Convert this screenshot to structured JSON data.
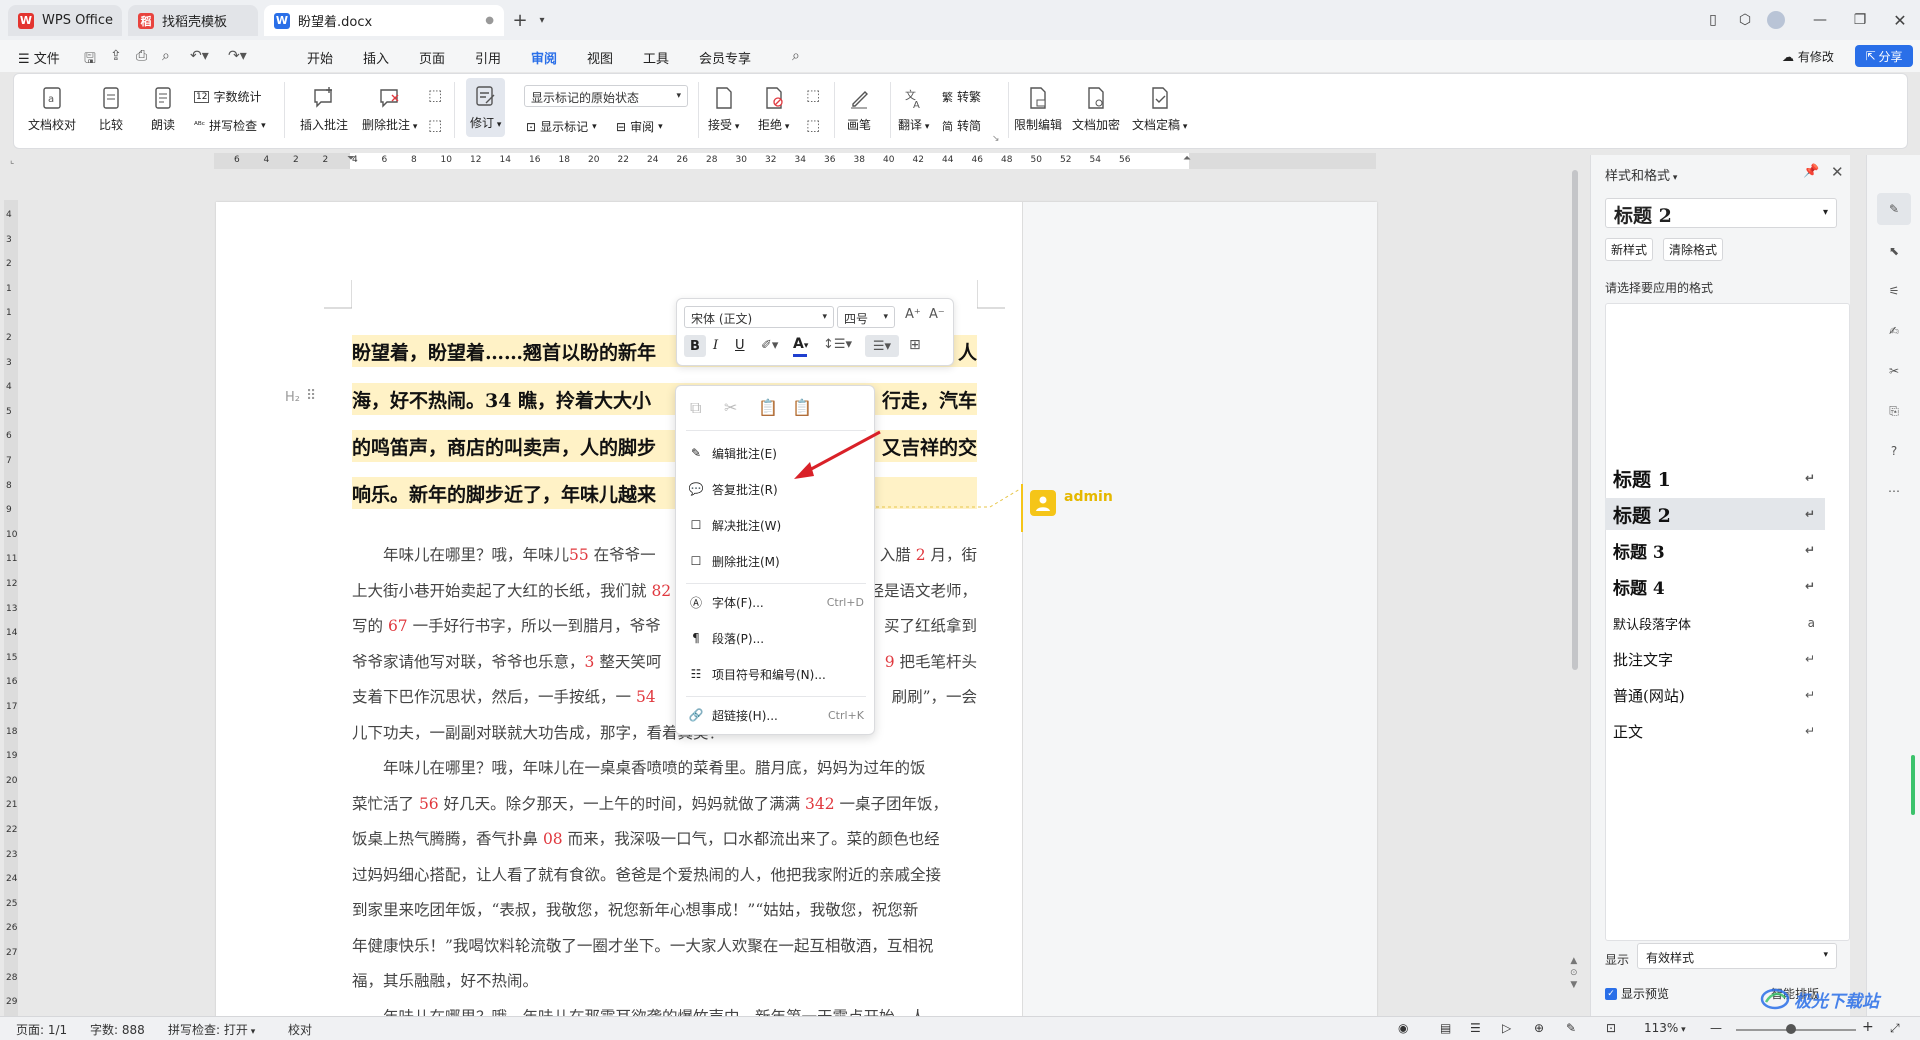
{
  "tabs": [
    {
      "label": "WPS Office",
      "icon": "wps-logo-icon"
    },
    {
      "label": "找稻壳模板",
      "icon": "docer-icon"
    },
    {
      "label": "盼望着.docx",
      "icon": "word-doc-icon"
    }
  ],
  "menubar": {
    "file": "文件",
    "items": [
      "开始",
      "插入",
      "页面",
      "引用",
      "审阅",
      "视图",
      "工具",
      "会员专享"
    ],
    "active": "审阅",
    "modified": "有修改",
    "share": "分享"
  },
  "ribbon": {
    "doc_check": "文档校对",
    "compare": "比较",
    "read_aloud": "朗读",
    "word_count": "字数统计",
    "spell_check": "拼写检查",
    "insert_comment": "插入批注",
    "delete_comment": "删除批注",
    "track": "修订",
    "display_mode": "显示标记的原始状态",
    "show_markup": "显示标记",
    "review": "审阅",
    "accept": "接受",
    "reject": "拒绝",
    "ink": "画笔",
    "translate": "翻译",
    "to_traditional": "转繁",
    "to_simplified": "转简",
    "restrict_edit": "限制编辑",
    "encrypt": "文档加密",
    "finalize": "文档定稿"
  },
  "ruler": {
    "h_ticks": [
      "6",
      "4",
      "2",
      "2",
      "4",
      "6",
      "8",
      "10",
      "12",
      "14",
      "16",
      "18",
      "20",
      "22",
      "24",
      "26",
      "28",
      "30",
      "32",
      "34",
      "36",
      "38",
      "40",
      "42",
      "44",
      "46",
      "48",
      "50",
      "52",
      "54",
      "56"
    ],
    "v_ticks": [
      "4",
      "3",
      "2",
      "1",
      "1",
      "2",
      "3",
      "4",
      "5",
      "6",
      "7",
      "8",
      "9",
      "10",
      "11",
      "12",
      "13",
      "14",
      "15",
      "16",
      "17",
      "18",
      "19",
      "20",
      "21",
      "22",
      "23",
      "24",
      "25",
      "26",
      "27",
      "28",
      "29"
    ]
  },
  "document": {
    "heading_marker": "H₂",
    "heading_lines": [
      {
        "left": "盼望着，盼望着……翘首以盼的新年",
        "right": "人"
      },
      {
        "left": "海，好不热闹。34 瞧，拎着大大小",
        "right": "行走，汽车"
      },
      {
        "left": "的鸣笛声，商店的叫卖声，人的脚步",
        "right": "又吉祥的交"
      },
      {
        "left": "响乐。新年的脚步近了，年味儿越来",
        "right": ""
      }
    ],
    "body_lines": [
      {
        "parts": [
          [
            "　　年味儿在哪里？哦，年味儿",
            0
          ],
          [
            "55",
            1
          ],
          [
            " 在爷爷一",
            0
          ]
        ],
        "right": [
          [
            "入腊 ",
            0
          ],
          [
            "2",
            1
          ],
          [
            " 月，街",
            0
          ]
        ]
      },
      {
        "parts": [
          [
            "上大街小巷开始卖起了大红的长纸，我们就 ",
            0
          ],
          [
            "82",
            1
          ]
        ],
        "right": [
          [
            "经是语文老师，",
            0
          ]
        ]
      },
      {
        "parts": [
          [
            "写的 ",
            0
          ],
          [
            "67",
            1
          ],
          [
            " 一手好行书字，所以一到腊月，爷爷",
            0
          ]
        ],
        "right": [
          [
            "买了红纸拿到",
            0
          ]
        ]
      },
      {
        "parts": [
          [
            "爷爷家请他写对联，爷爷也乐意，",
            0
          ],
          [
            "3",
            1
          ],
          [
            " 整天笑呵",
            0
          ]
        ],
        "right": [
          [
            "",
            0
          ],
          [
            "9",
            1
          ],
          [
            " 把毛笔杆头",
            0
          ]
        ]
      },
      {
        "parts": [
          [
            "支着下巴作沉思状，然后，一手按纸，一 ",
            0
          ],
          [
            "54",
            1
          ]
        ],
        "right": [
          [
            "刷刷”，一会",
            0
          ]
        ]
      },
      {
        "parts": [
          [
            "儿下功夫，一副副对联就大功告成，那字，看着真美！",
            0
          ]
        ],
        "right": []
      },
      {
        "parts": [
          [
            "　　年味儿在哪里？哦，年味儿在一桌桌香喷喷的菜肴里。腊月底，妈妈为过年的饭",
            0
          ]
        ],
        "right": []
      },
      {
        "parts": [
          [
            "菜忙活了 ",
            0
          ],
          [
            "56",
            1
          ],
          [
            " 好几天。除夕那天，一上午的时间，妈妈就做了满满 ",
            0
          ],
          [
            "342",
            1
          ],
          [
            " 一桌子团年饭，",
            0
          ]
        ],
        "right": []
      },
      {
        "parts": [
          [
            "饭桌上热气腾腾，香气扑鼻 ",
            0
          ],
          [
            "08",
            1
          ],
          [
            " 而来，我深吸一口气，口水都流出来了。菜的颜色也经",
            0
          ]
        ],
        "right": []
      },
      {
        "parts": [
          [
            "过妈妈细心搭配，让人看了就有食欲。爸爸是个爱热闹的人，他把我家附近的亲戚全接",
            0
          ]
        ],
        "right": []
      },
      {
        "parts": [
          [
            "到家里来吃团年饭，“表叔，我敬您，祝您新年心想事成！”“姑姑，我敬您，祝您新",
            0
          ]
        ],
        "right": []
      },
      {
        "parts": [
          [
            "年健康快乐！”我喝饮料轮流敬了一圈才坐下。一大家人欢聚在一起互相敬酒，互相祝",
            0
          ]
        ],
        "right": []
      },
      {
        "parts": [
          [
            "福，其乐融融，好不热闹。",
            0
          ]
        ],
        "right": []
      },
      {
        "parts": [
          [
            "　　年味儿在哪里？哦，年味儿在那震耳欲聋的爆竹声中。新年第一天零点开始，人",
            0
          ]
        ],
        "right": []
      }
    ],
    "comment_author": "admin"
  },
  "float_toolbar": {
    "font": "宋体 (正文)",
    "size": "四号",
    "grow": "A⁺",
    "shrink": "A⁻",
    "bold": "B",
    "italic": "I",
    "underline": "U",
    "font_color": "#1f3fcf"
  },
  "context_menu": {
    "items": [
      {
        "label": "编辑批注(E)",
        "shortcut": "",
        "icon": "edit-comment-icon"
      },
      {
        "label": "答复批注(R)",
        "shortcut": "",
        "icon": "reply-comment-icon"
      },
      {
        "label": "解决批注(W)",
        "shortcut": "",
        "icon": "resolve-comment-icon"
      },
      {
        "label": "删除批注(M)",
        "shortcut": "",
        "icon": "delete-comment-icon"
      },
      {
        "label": "字体(F)...",
        "shortcut": "Ctrl+D",
        "icon": "font-icon"
      },
      {
        "label": "段落(P)...",
        "shortcut": "",
        "icon": "paragraph-icon"
      },
      {
        "label": "项目符号和编号(N)...",
        "shortcut": "",
        "icon": "bullets-icon"
      },
      {
        "label": "超链接(H)...",
        "shortcut": "Ctrl+K",
        "icon": "hyperlink-icon"
      }
    ]
  },
  "styles_panel": {
    "title": "样式和格式",
    "current": "标题 2",
    "new_style": "新样式",
    "clear_format": "清除格式",
    "prompt": "请选择要应用的格式",
    "items": [
      {
        "label": "标题 1",
        "size": 19,
        "bold": true,
        "mark": "↵"
      },
      {
        "label": "标题 2",
        "size": 19,
        "bold": true,
        "mark": "↵"
      },
      {
        "label": "标题 3",
        "size": 17,
        "bold": true,
        "mark": "↵"
      },
      {
        "label": "标题 4",
        "size": 17,
        "bold": true,
        "mark": "↵"
      },
      {
        "label": "默认段落字体",
        "size": 13,
        "bold": false,
        "mark": "a"
      },
      {
        "label": "批注文字",
        "size": 15,
        "bold": false,
        "mark": "↵"
      },
      {
        "label": "普通(网站)",
        "size": 15,
        "bold": false,
        "mark": "↵"
      },
      {
        "label": "正文",
        "size": 15,
        "bold": false,
        "mark": "↵"
      }
    ],
    "selected_index": 1,
    "show_label": "显示",
    "show_value": "有效样式",
    "preview": "显示预览",
    "smart_layout": "智能排版"
  },
  "statusbar": {
    "page": "页面: 1/1",
    "words": "字数: 888",
    "spell": "拼写检查: 打开",
    "proof": "校对",
    "zoom": "113%"
  },
  "watermark": "极光下载站",
  "colors": {
    "accent": "#2a6fe8",
    "highlight": "#fff2c6",
    "red_number": "#e0383e",
    "comment_yellow": "#f5c518"
  }
}
